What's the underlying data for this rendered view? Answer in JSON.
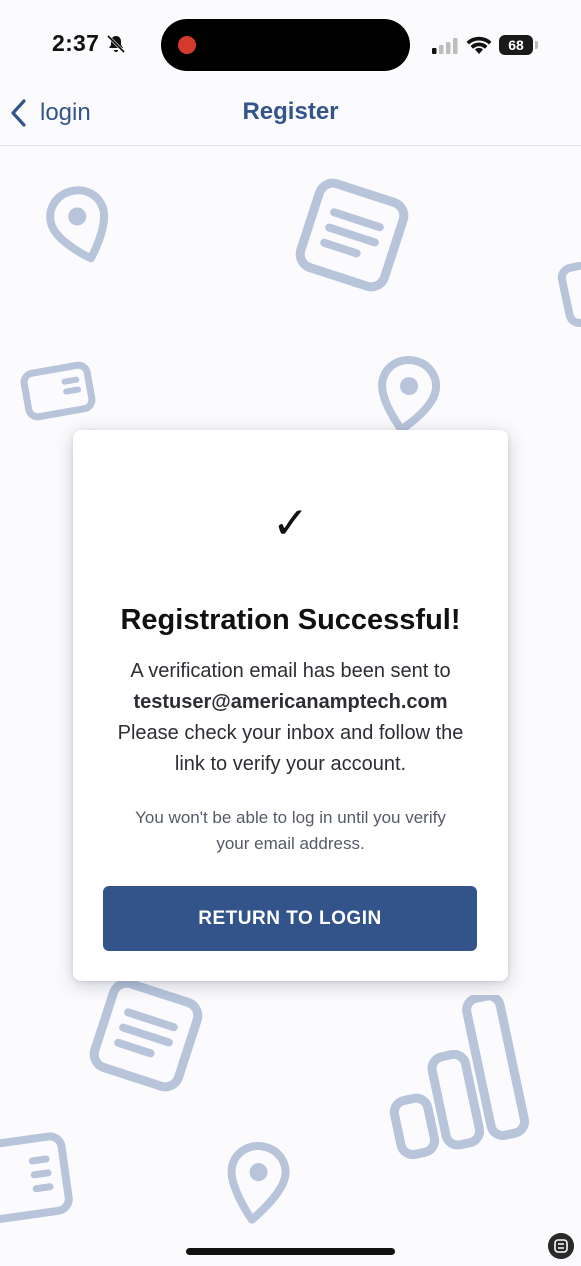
{
  "status_bar": {
    "time": "2:37",
    "battery": "68"
  },
  "nav": {
    "back_label": "login",
    "title": "Register"
  },
  "card": {
    "check_glyph": "✓",
    "title": "Registration Successful!",
    "line1": "A verification email has been sent to",
    "email": "testuser@americanamptech.com",
    "line3": "Please check your inbox and follow the",
    "line4": "link to verify your account.",
    "note_line1": "You won't be able to log in until you verify",
    "note_line2": "your email address.",
    "button_label": "RETURN TO LOGIN"
  },
  "colors": {
    "accent": "#33548a",
    "bg_icon": "#b7c4da",
    "background": "#fbfbfd"
  },
  "icons": [
    "bell-slash-icon",
    "signal-icon",
    "wifi-icon",
    "battery-icon",
    "chevron-left-icon",
    "location-pin-icon",
    "document-icon",
    "card-icon",
    "bar-chart-icon",
    "checkmark-icon"
  ]
}
